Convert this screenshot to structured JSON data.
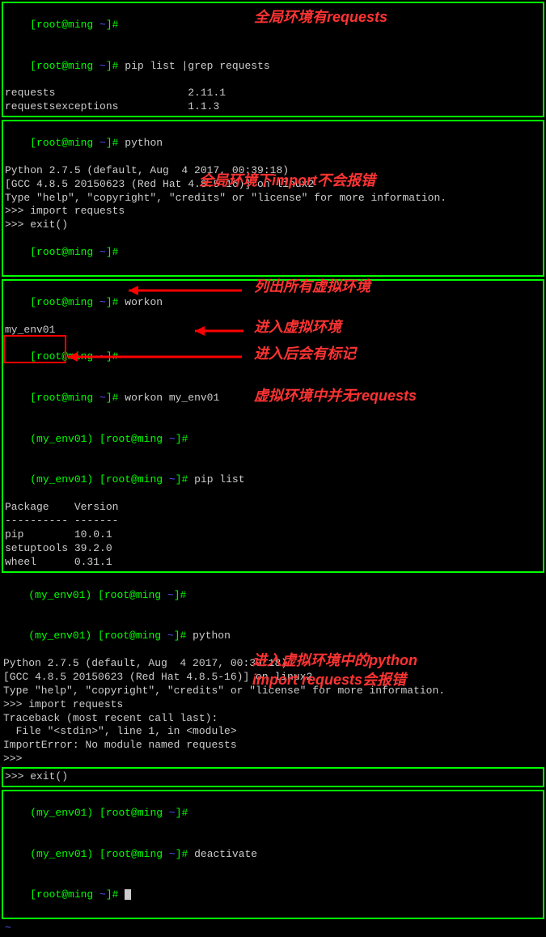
{
  "prompt": {
    "user_host": "[root@ming ",
    "path": "~",
    "end": "]# "
  },
  "env_prefix": "(my_env01) ",
  "box1": {
    "lines": [
      "",
      "pip list |grep requests",
      "requests                     2.11.1",
      "requestsexceptions           1.1.3"
    ],
    "annotation": "全局环境有requests"
  },
  "box2": {
    "cmd": "python",
    "py_banner1": "Python 2.7.5 (default, Aug  4 2017, 00:39:18)",
    "py_banner2": "[GCC 4.8.5 20150623 (Red Hat 4.8.5-16)] on linux2",
    "py_help": "Type \"help\", \"copyright\", \"credits\" or \"license\" for more information.",
    "import_req": ">>> import requests",
    "exit_call": ">>> exit()",
    "prompt_after": "",
    "annotation": "全局环境下import不会报错"
  },
  "box3": {
    "workon_cmd": "workon",
    "env_name": "my_env01",
    "workon_env_cmd": "workon my_env01",
    "pip_list_cmd": "pip list",
    "piptable_header": "Package    Version",
    "piptable_sep": "---------- -------",
    "pkg_pip": "pip        10.0.1",
    "pkg_setuptools": "setuptools 39.2.0",
    "pkg_wheel": "wheel      0.31.1",
    "ann_list": "列出所有虚拟环境",
    "ann_enter": "进入虚拟环境",
    "ann_mark": "进入后会有标记",
    "ann_noreq": "虚拟环境中并无requests"
  },
  "section4": {
    "python_cmd": "python",
    "py_banner1": "Python 2.7.5 (default, Aug  4 2017, 00:39:18)",
    "py_banner2": "[GCC 4.8.5 20150623 (Red Hat 4.8.5-16)] on linux2",
    "py_help": "Type \"help\", \"copyright\", \"credits\" or \"license\" for more information.",
    "import_req": ">>> import requests",
    "traceback": "Traceback (most recent call last):",
    "file_line": "  File \"<stdin>\", line 1, in <module>",
    "import_err": "ImportError: No module named requests",
    "py_cont": ">>>",
    "exit_call": ">>> exit()",
    "ann1": "进入虚拟环境中的python",
    "ann2": "import requests会报错"
  },
  "box5": {
    "deactivate_cmd": "deactivate",
    "tilde": "~"
  }
}
